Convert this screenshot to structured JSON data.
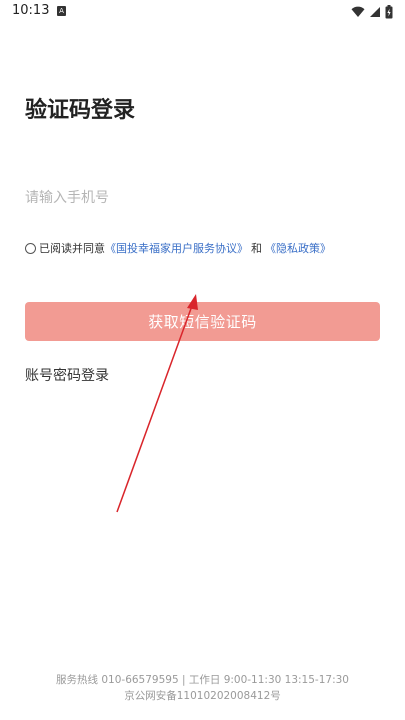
{
  "status_bar": {
    "time": "10:13",
    "sim_badge": "A",
    "icons": [
      "wifi-icon",
      "signal-icon",
      "battery-icon"
    ]
  },
  "page": {
    "title": "验证码登录",
    "phone_placeholder": "请输入手机号",
    "agreement": {
      "prefix": "已阅读并同意",
      "service_link": "《国投幸福家用户服务协议》",
      "connector": "和",
      "privacy_link": "《隐私政策》"
    },
    "submit_label": "获取短信验证码",
    "alt_login_label": "账号密码登录",
    "footer_line1": "服务热线 010-66579595 | 工作日 9:00-11:30 13:15-17:30",
    "footer_line2": "京公网安备11010202008412号"
  },
  "colors": {
    "accent_button": "#f29b93",
    "link": "#3a6fc7",
    "annotation_arrow": "#d9252b"
  }
}
